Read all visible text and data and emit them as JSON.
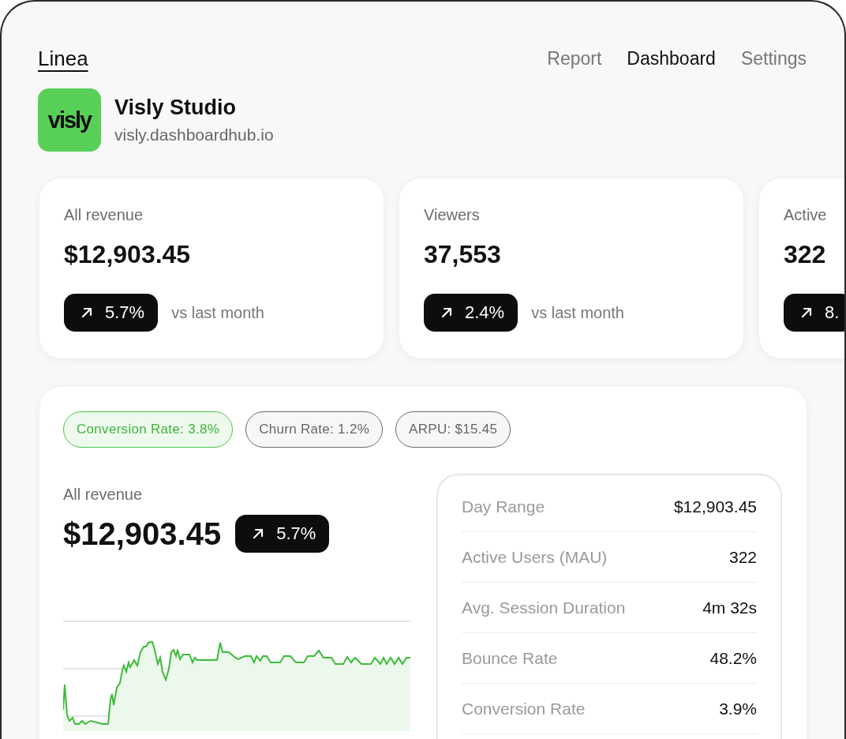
{
  "brand": "Linea",
  "nav": [
    {
      "label": "Report",
      "selected": false
    },
    {
      "label": "Dashboard",
      "selected": true
    },
    {
      "label": "Settings",
      "selected": false
    }
  ],
  "company": {
    "logo_text": "visly",
    "name": "Visly Studio",
    "domain": "visly.dashboardhub.io"
  },
  "stat_cards": [
    {
      "label": "All revenue",
      "value": "$12,903.45",
      "change": "5.7%",
      "note": "vs last month"
    },
    {
      "label": "Viewers",
      "value": "37,553",
      "change": "2.4%",
      "note": "vs last month"
    },
    {
      "label": "Active",
      "value": "322",
      "change": "8."
    }
  ],
  "chips": [
    {
      "label": "Conversion Rate: 3.8%",
      "selected": true
    },
    {
      "label": "Churn Rate: 1.2%",
      "selected": false
    },
    {
      "label": "ARPU: $15.45",
      "selected": false
    }
  ],
  "revenue": {
    "label": "All revenue",
    "value": "$12,903.45",
    "change": "5.7%"
  },
  "metrics": [
    {
      "label": "Day Range",
      "value": "$12,903.45"
    },
    {
      "label": "Active Users (MAU)",
      "value": "322"
    },
    {
      "label": "Avg. Session Duration",
      "value": "4m 32s"
    },
    {
      "label": "Bounce Rate",
      "value": "48.2%"
    },
    {
      "label": "Conversion Rate",
      "value": "3.9%"
    }
  ]
}
